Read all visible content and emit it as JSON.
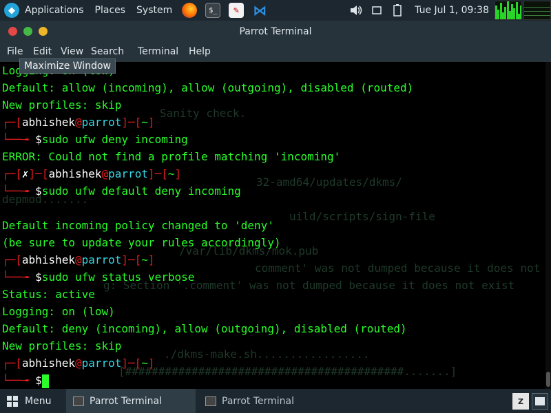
{
  "top_panel": {
    "applications_label": "Applications",
    "places_label": "Places",
    "system_label": "System",
    "clock": "Tue Jul 1, 09:38"
  },
  "window": {
    "title": "Parrot Terminal",
    "tooltip": "Maximize Window",
    "menu": [
      "File",
      "Edit",
      "View",
      "Search",
      "Terminal",
      "Help"
    ]
  },
  "terminal": {
    "lines": [
      [
        {
          "t": "Logging: on (low)",
          "c": "g"
        }
      ],
      [
        {
          "t": "Default: allow (incoming), allow (outgoing), disabled (routed)",
          "c": "g"
        }
      ],
      [
        {
          "t": "New profiles: skip",
          "c": "g"
        }
      ],
      [
        {
          "t": "┌─[",
          "c": "r"
        },
        {
          "t": "abhishek",
          "c": "w"
        },
        {
          "t": "@",
          "c": "r"
        },
        {
          "t": "parrot",
          "c": "c"
        },
        {
          "t": "]─[",
          "c": "r"
        },
        {
          "t": "~",
          "c": "g"
        },
        {
          "t": "]",
          "c": "r"
        }
      ],
      [
        {
          "t": "└──╼ ",
          "c": "r"
        },
        {
          "t": "$",
          "c": "w"
        },
        {
          "t": "sudo ufw deny incoming",
          "c": "g"
        }
      ],
      [
        {
          "t": "ERROR: Could not find a profile matching 'incoming'",
          "c": "g"
        }
      ],
      [
        {
          "t": "┌─[",
          "c": "r"
        },
        {
          "t": "✗",
          "c": "w"
        },
        {
          "t": "]─[",
          "c": "r"
        },
        {
          "t": "abhishek",
          "c": "w"
        },
        {
          "t": "@",
          "c": "r"
        },
        {
          "t": "parrot",
          "c": "c"
        },
        {
          "t": "]─[",
          "c": "r"
        },
        {
          "t": "~",
          "c": "g"
        },
        {
          "t": "]",
          "c": "r"
        }
      ],
      [
        {
          "t": "└──╼ ",
          "c": "r"
        },
        {
          "t": "$",
          "c": "w"
        },
        {
          "t": "sudo ufw default deny incoming",
          "c": "g"
        }
      ],
      [
        {
          "t": "",
          "c": "g"
        }
      ],
      [
        {
          "t": "Default incoming policy changed to 'deny'",
          "c": "g"
        }
      ],
      [
        {
          "t": "(be sure to update your rules accordingly)",
          "c": "g"
        }
      ],
      [
        {
          "t": "┌─[",
          "c": "r"
        },
        {
          "t": "abhishek",
          "c": "w"
        },
        {
          "t": "@",
          "c": "r"
        },
        {
          "t": "parrot",
          "c": "c"
        },
        {
          "t": "]─[",
          "c": "r"
        },
        {
          "t": "~",
          "c": "g"
        },
        {
          "t": "]",
          "c": "r"
        }
      ],
      [
        {
          "t": "└──╼ ",
          "c": "r"
        },
        {
          "t": "$",
          "c": "w"
        },
        {
          "t": "sudo ufw status verbose",
          "c": "g"
        }
      ],
      [
        {
          "t": "Status: active",
          "c": "g"
        }
      ],
      [
        {
          "t": "Logging: on (low)",
          "c": "g"
        }
      ],
      [
        {
          "t": "Default: deny (incoming), allow (outgoing), disabled (routed)",
          "c": "g"
        }
      ],
      [
        {
          "t": "New profiles: skip",
          "c": "g"
        }
      ],
      [
        {
          "t": "┌─[",
          "c": "r"
        },
        {
          "t": "abhishek",
          "c": "w"
        },
        {
          "t": "@",
          "c": "r"
        },
        {
          "t": "parrot",
          "c": "c"
        },
        {
          "t": "]─[",
          "c": "r"
        },
        {
          "t": "~",
          "c": "g"
        },
        {
          "t": "]",
          "c": "r"
        }
      ],
      [
        {
          "t": "└──╼ ",
          "c": "r"
        },
        {
          "t": "$",
          "c": "w"
        }
      ]
    ],
    "ghost_lines": [
      "Sanity check.",
      "32-amd64/updates/dkms/",
      "depmod.......",
      "uild/scripts/sign-file",
      "/var/lib/dkms/mok.pub",
      "comment' was not dumped because it does not exist",
      "g: Section '.comment' was not dumped because it does not exist",
      "./dkms-make.sh.................",
      "[##########################################.......]"
    ]
  },
  "taskbar": {
    "menu_label": "Menu",
    "tasks": [
      "Parrot Terminal",
      "Parrot Terminal"
    ]
  },
  "colors": {
    "green": "#2aff2a",
    "red": "#e41c1c",
    "cyan": "#36d7e6",
    "panel": "#1c2730"
  }
}
